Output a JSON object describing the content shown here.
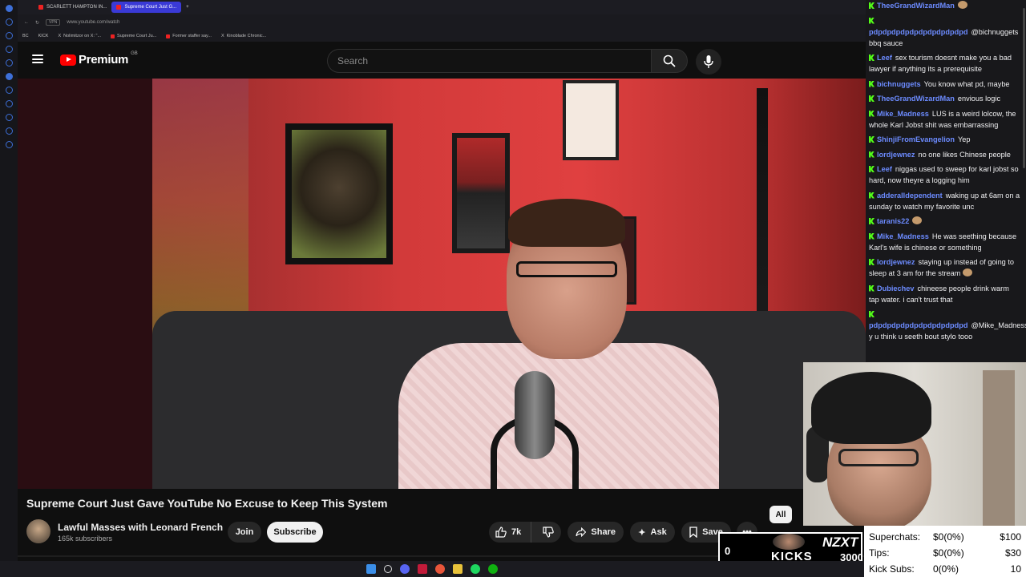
{
  "browser": {
    "tabs": [
      {
        "label": "SCARLETT HAMPTON IN...",
        "active": false
      },
      {
        "label": "Supreme Court Just G...",
        "active": true
      }
    ],
    "address": "www.youtube.com/watch",
    "vpn_label": "VPN",
    "bookmarks": [
      "BC",
      "KICK",
      "Nolimitzor on X: \"...",
      "Supreme Court Ju...",
      "Former staffer say...",
      "Kinoblade Chronic..."
    ]
  },
  "youtube": {
    "logo_text": "Premium",
    "country_code": "GB",
    "search_placeholder": "Search"
  },
  "video": {
    "title": "Supreme Court Just Gave YouTube No Excuse to Keep This System",
    "channel": "Lawful Masses with Leonard French",
    "subscribers": "165k subscribers",
    "join_label": "Join",
    "subscribe_label": "Subscribe",
    "likes": "7k",
    "share_label": "Share",
    "ask_label": "Ask",
    "save_label": "Save",
    "filter_chip": "All"
  },
  "chat": {
    "messages": [
      {
        "user": "TheeGrandWizardMan",
        "color": "#6c8bff",
        "text": ""
      },
      {
        "user": "pdpdpdpdpdpdpdpdpdpdpd",
        "color": "#6c8bff",
        "text": "@bichnuggets bbq sauce"
      },
      {
        "user": "Leef",
        "color": "#6c8bff",
        "text": "sex tourism doesnt make you a bad lawyer if anything its a prerequisite"
      },
      {
        "user": "bichnuggets",
        "color": "#6c8bff",
        "text": "You know what pd, maybe"
      },
      {
        "user": "TheeGrandWizardMan",
        "color": "#6c8bff",
        "text": "envious logic"
      },
      {
        "user": "Mike_Madness",
        "color": "#6c8bff",
        "text": "LUS is a weird lolcow, the whole Karl Jobst shit was embarrassing"
      },
      {
        "user": "ShinjiFromEvangelion",
        "color": "#6c8bff",
        "text": "Yep"
      },
      {
        "user": "lordjewnez",
        "color": "#6c8bff",
        "text": "no one likes Chinese people"
      },
      {
        "user": "Leef",
        "color": "#6c8bff",
        "text": "niggas used to sweep for karl jobst so hard, now theyre a logging him"
      },
      {
        "user": "adderalldependent",
        "color": "#6c8bff",
        "text": "waking up at 6am on a sunday to watch my favorite unc"
      },
      {
        "user": "taranis22",
        "color": "#6c8bff",
        "text": ""
      },
      {
        "user": "Mike_Madness",
        "color": "#6c8bff",
        "text": "He was seething because Karl's wife is chinese or something"
      },
      {
        "user": "lordjewnez",
        "color": "#6c8bff",
        "text": "staying up instead of going to sleep at 3 am for the stream"
      },
      {
        "user": "Dubiechev",
        "color": "#6c8bff",
        "text": "chineese people drink warm tap water. i can't trust that"
      },
      {
        "user": "pdpdpdpdpdpdpdpdpdpdpd",
        "color": "#6c8bff",
        "text": "@Mike_Madness y u think u seeth bout stylo tooo"
      }
    ]
  },
  "stats": {
    "rows": [
      {
        "label": "Superchats:",
        "value": "$0(0%)",
        "goal": "$100"
      },
      {
        "label": "Tips:",
        "value": "$0(0%)",
        "goal": "$30"
      },
      {
        "label": "Kick Subs:",
        "value": "0(0%)",
        "goal": "10"
      }
    ]
  },
  "kicks_widget": {
    "count": "0",
    "label": "KICKS",
    "brand": "NZXT",
    "goal": "3000"
  }
}
